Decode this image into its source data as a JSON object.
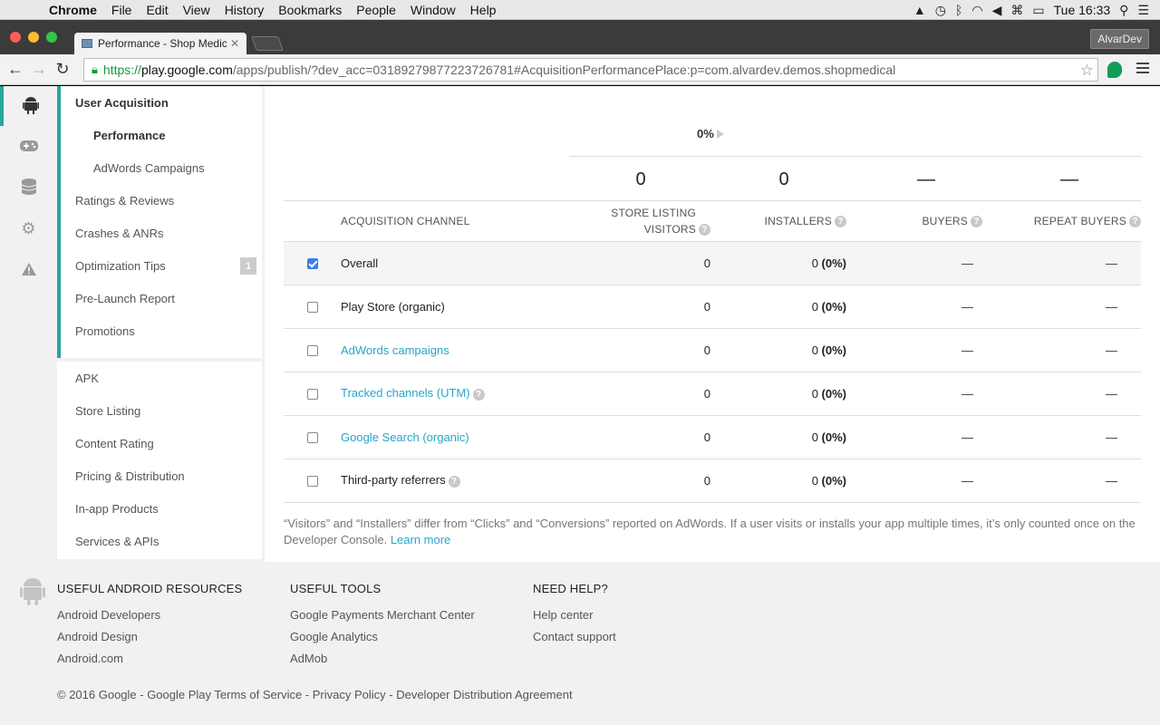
{
  "menubar": {
    "app": "Chrome",
    "items": [
      "File",
      "Edit",
      "View",
      "History",
      "Bookmarks",
      "People",
      "Window",
      "Help"
    ],
    "clock": "Tue 16:33"
  },
  "browser": {
    "tab_title": "Performance - Shop Medic",
    "profile": "AlvarDev",
    "url_scheme": "https://",
    "url_host": "play.google.com",
    "url_path": "/apps/publish/?dev_acc=03189279877223726781#AcquisitionPerformancePlace:p=com.alvardev.demos.shopmedical"
  },
  "rail": [
    "android-icon",
    "gamepad-icon",
    "database-icon",
    "gear-icon",
    "warning-icon"
  ],
  "nav": {
    "section": "User Acquisition",
    "sub_active": "Performance",
    "sub_other": "AdWords Campaigns",
    "items1": [
      "Ratings & Reviews",
      "Crashes & ANRs",
      "Optimization Tips",
      "Pre-Launch Report",
      "Promotions"
    ],
    "optimization_badge": "1",
    "items2": [
      "APK",
      "Store Listing",
      "Content Rating",
      "Pricing & Distribution",
      "In-app Products",
      "Services & APIs"
    ]
  },
  "summary": {
    "pct": "0%",
    "totals": [
      "0",
      "0",
      "—",
      "—"
    ]
  },
  "table": {
    "headers": {
      "channel": "Acquisition channel",
      "visitors": "Store listing visitors",
      "installers": "Installers",
      "buyers": "Buyers",
      "repeat": "Repeat buyers"
    },
    "rows": [
      {
        "checked": true,
        "channel": "Overall",
        "link": false,
        "help": false,
        "visitors": "0",
        "inst_num": "0",
        "inst_pct": "(0%)",
        "buyers": "—",
        "repeat": "—"
      },
      {
        "checked": false,
        "channel": "Play Store (organic)",
        "link": false,
        "help": false,
        "visitors": "0",
        "inst_num": "0",
        "inst_pct": "(0%)",
        "buyers": "—",
        "repeat": "—"
      },
      {
        "checked": false,
        "channel": "AdWords campaigns",
        "link": true,
        "help": false,
        "visitors": "0",
        "inst_num": "0",
        "inst_pct": "(0%)",
        "buyers": "—",
        "repeat": "—"
      },
      {
        "checked": false,
        "channel": "Tracked channels (UTM)",
        "link": true,
        "help": true,
        "visitors": "0",
        "inst_num": "0",
        "inst_pct": "(0%)",
        "buyers": "—",
        "repeat": "—"
      },
      {
        "checked": false,
        "channel": "Google Search (organic)",
        "link": true,
        "help": false,
        "visitors": "0",
        "inst_num": "0",
        "inst_pct": "(0%)",
        "buyers": "—",
        "repeat": "—"
      },
      {
        "checked": false,
        "channel": "Third-party referrers",
        "link": false,
        "help": true,
        "visitors": "0",
        "inst_num": "0",
        "inst_pct": "(0%)",
        "buyers": "—",
        "repeat": "—"
      }
    ]
  },
  "footnote": {
    "text": "“Visitors” and “Installers” differ from “Clicks” and “Conversions” reported on AdWords. If a user visits or installs your app multiple times, it’s only counted once on the Developer Console.",
    "link": "Learn more"
  },
  "footer": {
    "col1": {
      "title": "Useful Android Resources",
      "links": [
        "Android Developers",
        "Android Design",
        "Android.com"
      ]
    },
    "col2": {
      "title": "Useful Tools",
      "links": [
        "Google Payments Merchant Center",
        "Google Analytics",
        "AdMob"
      ]
    },
    "col3": {
      "title": "Need help?",
      "links": [
        "Help center",
        "Contact support"
      ]
    },
    "copyright": "© 2016 Google - Google Play Terms of Service - Privacy Policy - Developer Distribution Agreement"
  },
  "colors": {
    "accent": "#26a69a",
    "link": "#27a5c8",
    "check": "#3a7ef0"
  }
}
